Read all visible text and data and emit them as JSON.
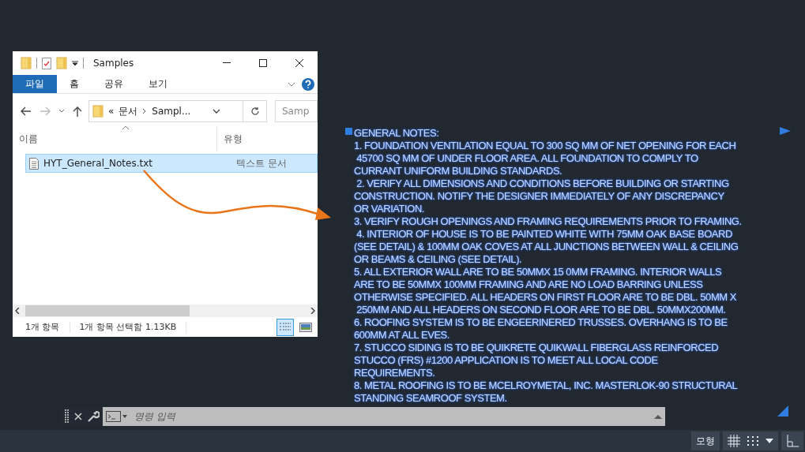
{
  "explorer": {
    "title": "Samples",
    "ribbon_tabs": [
      {
        "label": "파일",
        "selected": true
      },
      {
        "label": "홈",
        "selected": false
      },
      {
        "label": "공유",
        "selected": false
      },
      {
        "label": "보기",
        "selected": false
      }
    ],
    "address": {
      "prefix": "«",
      "segments": [
        "문서",
        "Sampl..."
      ]
    },
    "search": {
      "placeholder": "Samp"
    },
    "columns": [
      "이름",
      "유형"
    ],
    "files": [
      {
        "name": "HYT_General_Notes.txt",
        "type": "텍스트 문서",
        "selected": true
      }
    ],
    "status": {
      "count": "1개 항목",
      "selection": "1개 항목 선택함 1.13KB"
    },
    "views": [
      {
        "kind": "details",
        "selected": true
      },
      {
        "kind": "thumbnails",
        "selected": false
      }
    ]
  },
  "notes": {
    "title": "GENERAL NOTES:",
    "paragraphs": [
      [
        "1. FOUNDATION VENTILATION EQUAL TO 300 SQ MM OF NET OPENING FOR EACH",
        " 45700 SQ MM OF UNDER FLOOR AREA. ALL FOUNDATION TO COMPLY TO",
        "CURRANT UNIFORM BUILDING STANDARDS."
      ],
      [
        " 2. VERIFY ALL DIMENSIONS AND CONDITIONS BEFORE BUILDING OR STARTING",
        "CONSTRUCTION. NOTIFY THE DESIGNER IMMEDIATELY OF ANY DISCREPANCY",
        "OR VARIATION."
      ],
      [
        "3. VERIFY ROUGH OPENINGS AND FRAMING REQUIREMENTS PRIOR TO FRAMING."
      ],
      [
        " 4. INTERIOR OF HOUSE IS TO BE PAINTED WHITE WITH 75MM OAK BASE BOARD",
        "(SEE DETAIL) & 100MM OAK COVES AT ALL JUNCTIONS BETWEEN WALL & CEILING",
        "OR BEAMS & CEILING (SEE DETAIL)."
      ],
      [
        "5. ALL EXTERIOR WALL ARE TO BE 50MMX 15 0MM FRAMING. INTERIOR WALLS",
        "ARE TO BE 50MMX 100MM FRAMING AND ARE NO LOAD BARRING UNLESS",
        "OTHERWISE SPECIFIED. ALL HEADERS ON FIRST FLOOR ARE TO BE DBL. 50MM X",
        " 250MM AND ALL HEADERS ON SECOND FLOOR ARE TO BE DBL. 50MMX200MM."
      ],
      [
        "6. ROOFING SYSTEM IS TO BE ENGEERINERED TRUSSES. OVERHANG IS TO BE",
        "600MM AT ALL EVES."
      ],
      [
        "7. STUCCO SIDING IS TO BE QUIKRETE QUIKWALL FIBERGLASS REINFORCED",
        "STUCCO (FRS) #1200 APPLICATION IS TO MEET ALL LOCAL CODE",
        "REQUIREMENTS."
      ],
      [
        "8. METAL ROOFING IS TO BE MCELROYMETAL, INC. MASTERLOK-90 STRUCTURAL",
        "STANDING SEAMROOF SYSTEM."
      ]
    ]
  },
  "command_line": {
    "placeholder": "명령 입력"
  },
  "status_bar": {
    "model": "모형"
  }
}
